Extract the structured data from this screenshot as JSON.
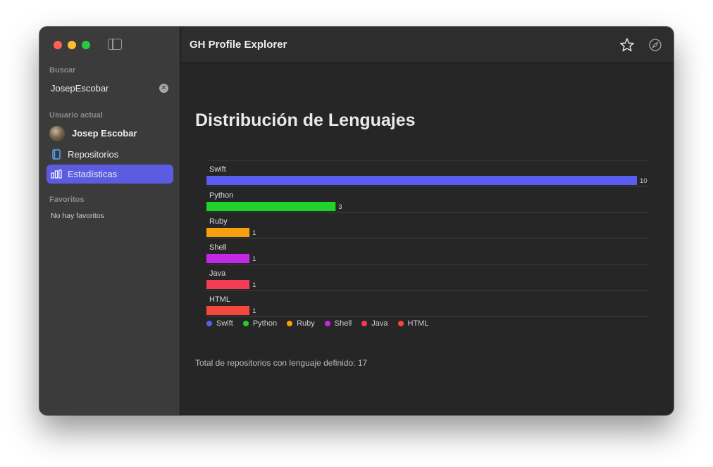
{
  "sidebar": {
    "search_section": "Buscar",
    "search_value": "JosepEscobar",
    "user_section": "Usuario actual",
    "user_name": "Josep Escobar",
    "nav": [
      {
        "label": "Repositorios",
        "icon": "book-icon",
        "active": false
      },
      {
        "label": "Estadísticas",
        "icon": "chart-bar-icon",
        "active": true
      }
    ],
    "favorites_section": "Favoritos",
    "favorites_empty": "No hay favoritos"
  },
  "toolbar": {
    "title": "GH Profile Explorer",
    "star_icon": "star-icon",
    "compass_icon": "compass-icon"
  },
  "main": {
    "heading": "Distribución de Lenguajes",
    "total_text": "Total de repositorios con lenguaje definido: 17"
  },
  "colors": {
    "accent": "#5b5ce2",
    "traffic_red": "#fe5f57",
    "traffic_yellow": "#febc2e",
    "traffic_green": "#28c840"
  },
  "chart_data": {
    "type": "bar",
    "orientation": "horizontal",
    "categories": [
      "Swift",
      "Python",
      "Ruby",
      "Shell",
      "Java",
      "HTML"
    ],
    "values": [
      10,
      3,
      1,
      1,
      1,
      1
    ],
    "colors": [
      "#5a5ef0",
      "#1ed22a",
      "#f5a00c",
      "#c328e6",
      "#f43b55",
      "#f5483a"
    ],
    "xlim": [
      0,
      10
    ],
    "legend": [
      "Swift",
      "Python",
      "Ruby",
      "Shell",
      "Java",
      "HTML"
    ],
    "legend_position": "bottom-left"
  }
}
